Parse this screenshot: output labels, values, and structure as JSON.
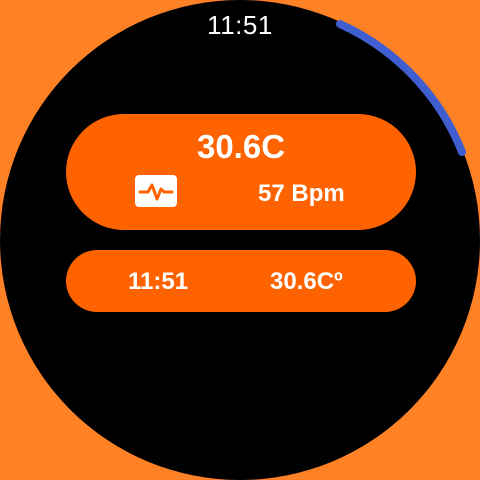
{
  "status_bar": {
    "time": "11:51"
  },
  "vitals_card": {
    "temperature": "30.6C",
    "heart_rate_icon": "heart-rate-monitor-icon",
    "heart_rate": "57 Bpm"
  },
  "summary_card": {
    "time": "11:51",
    "temperature": "30.6Cº"
  },
  "scroll_indicator": {
    "color": "#3F5FD0"
  },
  "colors": {
    "background": "#FF8126",
    "face": "#000000",
    "card": "#FF6300",
    "text": "#FFFFFF"
  }
}
